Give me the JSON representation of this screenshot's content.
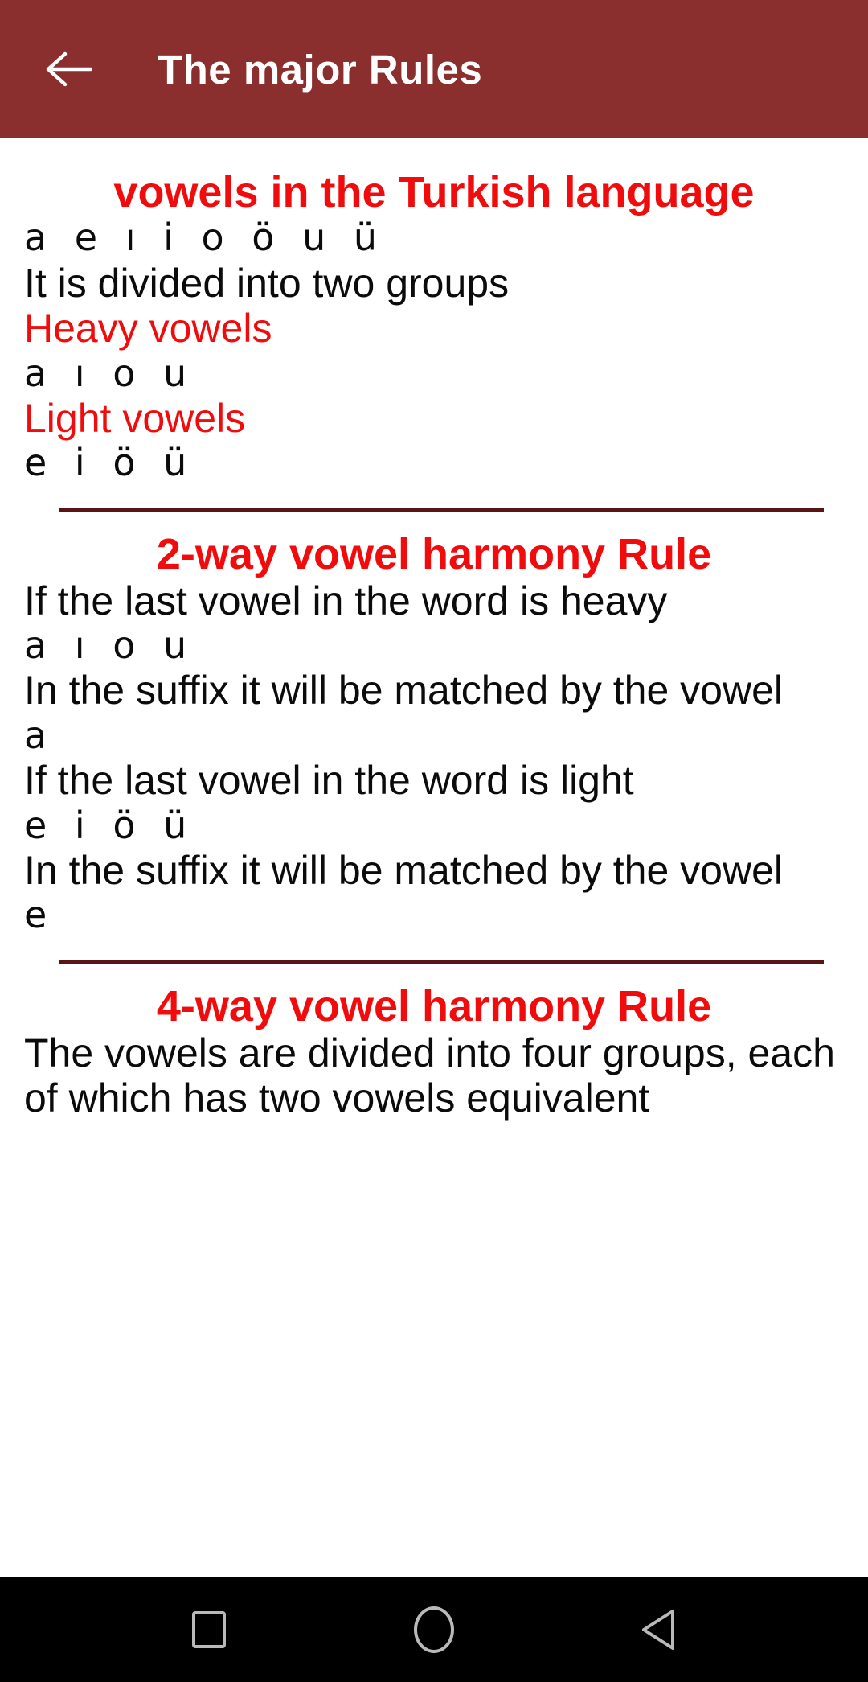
{
  "appbar": {
    "back_icon": "arrow-left-icon",
    "title": "The major Rules",
    "background": "#8B2E2E",
    "title_color": "#FFFFFF"
  },
  "theme": {
    "accent_red": "#F00C0C",
    "divider_color": "#5B1414",
    "body_text": "#0B0B0B",
    "page_background": "#FFFFFF"
  },
  "sections": [
    {
      "heading": "vowels in the Turkish language",
      "lines": [
        {
          "kind": "vowels",
          "text": "a e ı i o ö u ü"
        },
        {
          "kind": "body",
          "text": "It is divided into two groups"
        },
        {
          "kind": "subhead",
          "text": "Heavy vowels"
        },
        {
          "kind": "vowels",
          "text": "a ı o u"
        },
        {
          "kind": "subhead",
          "text": "Light vowels"
        },
        {
          "kind": "vowels",
          "text": "e i ö ü"
        }
      ]
    },
    {
      "heading": "2-way vowel harmony Rule",
      "lines": [
        {
          "kind": "body",
          "text": "If the last vowel in the word is heavy"
        },
        {
          "kind": "vowels",
          "text": "a ı o u"
        },
        {
          "kind": "body",
          "text": "In the suffix it will be matched by the vowel"
        },
        {
          "kind": "vowels",
          "text": "a"
        },
        {
          "kind": "body",
          "text": "If the last vowel in the word is light"
        },
        {
          "kind": "vowels",
          "text": "e i ö ü"
        },
        {
          "kind": "body",
          "text": "In the suffix it will be matched by the vowel"
        },
        {
          "kind": "vowels",
          "text": "e"
        }
      ]
    },
    {
      "heading": "4-way vowel harmony Rule",
      "lines": [
        {
          "kind": "body",
          "text": "The vowels are divided into four groups, each of which has two vowels equivalent"
        }
      ]
    }
  ],
  "navbar": {
    "recents_icon": "square-icon",
    "home_icon": "circle-icon",
    "back_icon": "triangle-left-icon"
  }
}
